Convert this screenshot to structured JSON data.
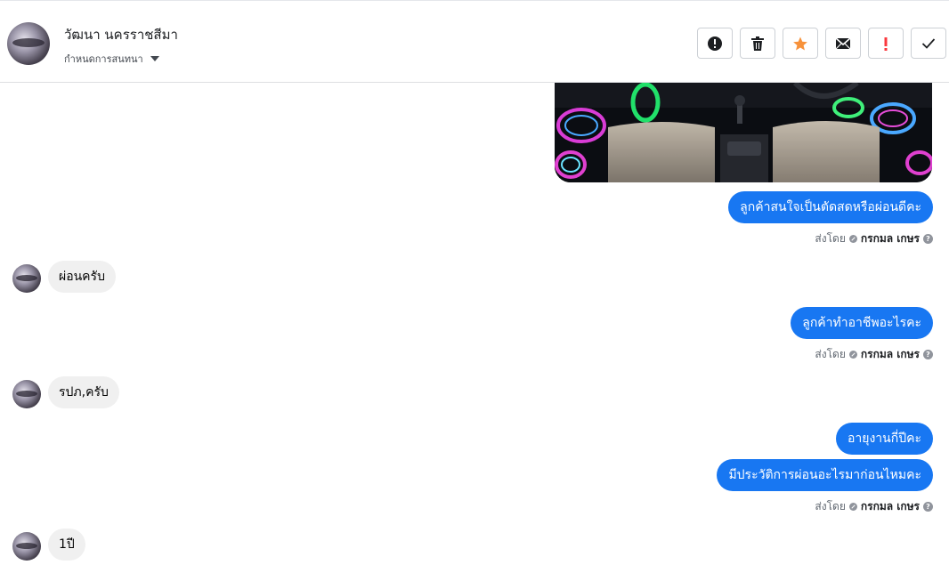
{
  "header": {
    "contact_name": "วัฒนา นครราชสีมา",
    "assign_label": "กำหนดการสนทนา",
    "actions": [
      {
        "icon": "alert-circle-icon",
        "label": "mark-spam"
      },
      {
        "icon": "trash-icon",
        "label": "delete"
      },
      {
        "icon": "star-icon",
        "label": "star",
        "color": "#f7923b"
      },
      {
        "icon": "envelope-icon",
        "label": "mark-unread"
      },
      {
        "icon": "exclamation-icon",
        "label": "follow-up",
        "color": "#fa383e"
      },
      {
        "icon": "check-icon",
        "label": "mark-done"
      }
    ]
  },
  "messages": [
    {
      "dir": "out",
      "text": "ลูกค้าสนใจเป็นตัดสดหรือผ่อนดีคะ"
    },
    {
      "dir": "in",
      "text": "ผ่อนครับ"
    },
    {
      "dir": "out",
      "text": "ลูกค้าทำอาชีพอะไรคะ"
    },
    {
      "dir": "in",
      "text": "รปภ,ครับ"
    },
    {
      "dir": "out",
      "text": "อายุงานกี่ปีคะ"
    },
    {
      "dir": "out",
      "text": "มีประวัติการผ่อนอะไรมาก่อนไหมคะ"
    },
    {
      "dir": "in",
      "text": "1ปี"
    }
  ],
  "sent_by": {
    "prefix": "ส่งโดย",
    "name": "กรกมล เกษร"
  },
  "colors": {
    "outgoing_bubble": "#1877f2",
    "incoming_bubble": "#f0f0f0"
  }
}
